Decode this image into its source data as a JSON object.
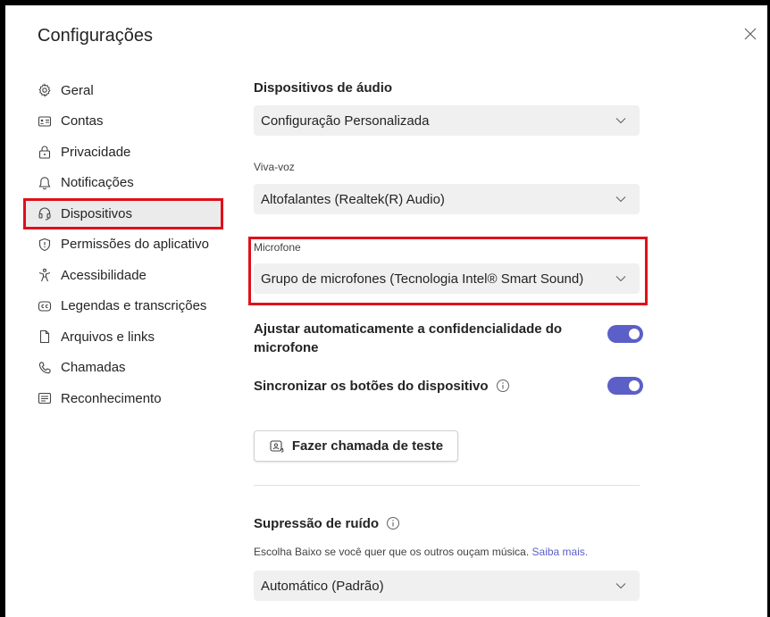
{
  "dialog": {
    "title": "Configurações"
  },
  "sidebar": {
    "items": [
      {
        "label": "Geral",
        "icon": "gear-icon"
      },
      {
        "label": "Contas",
        "icon": "id-card-icon"
      },
      {
        "label": "Privacidade",
        "icon": "lock-icon"
      },
      {
        "label": "Notificações",
        "icon": "bell-icon"
      },
      {
        "label": "Dispositivos",
        "icon": "headset-icon",
        "active": true
      },
      {
        "label": "Permissões do aplicativo",
        "icon": "shield-icon"
      },
      {
        "label": "Acessibilidade",
        "icon": "accessibility-icon"
      },
      {
        "label": "Legendas e transcrições",
        "icon": "closed-captions-icon"
      },
      {
        "label": "Arquivos e links",
        "icon": "file-icon"
      },
      {
        "label": "Chamadas",
        "icon": "phone-icon"
      },
      {
        "label": "Reconhecimento",
        "icon": "document-icon"
      }
    ]
  },
  "audio": {
    "title": "Dispositivos de áudio",
    "config_value": "Configuração Personalizada",
    "speaker_label": "Viva-voz",
    "speaker_value": "Altofalantes (Realtek(R) Audio)",
    "mic_label": "Microfone",
    "mic_value": "Grupo de microfones (Tecnologia Intel® Smart Sound)"
  },
  "toggles": {
    "auto_sensitivity_label": "Ajustar automaticamente a confidencialidade do microfone",
    "auto_sensitivity_on": true,
    "sync_buttons_label": "Sincronizar os botões do dispositivo",
    "sync_buttons_on": true
  },
  "test_call": {
    "label": "Fazer chamada de teste"
  },
  "noise": {
    "title": "Supressão de ruído",
    "description": "Escolha Baixo se você quer que os outros ouçam música.",
    "learn_more": "Saiba mais.",
    "value": "Automático (Padrão)"
  },
  "colors": {
    "accent": "#5b5fc7",
    "highlight": "#e0101a"
  }
}
